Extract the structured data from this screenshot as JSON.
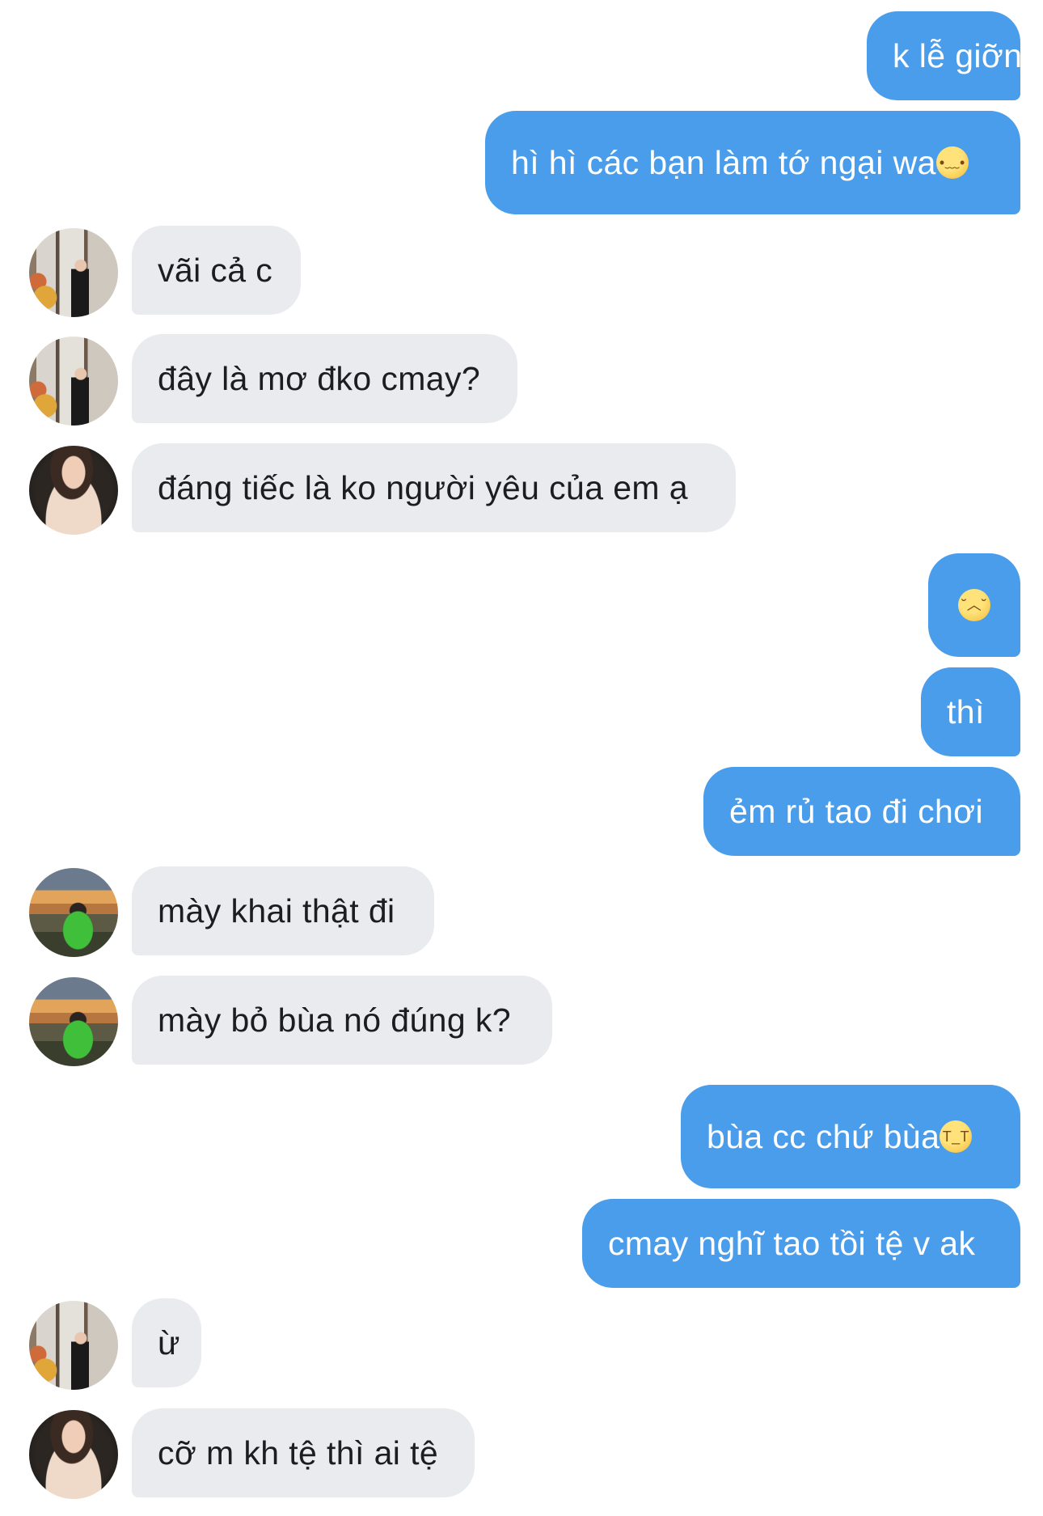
{
  "messages": [
    {
      "side": "out",
      "text": "k lễ giỡn"
    },
    {
      "side": "out",
      "text": "hì hì các bạn làm tớ ngại wa",
      "emoji": "shy-face-emoji"
    },
    {
      "side": "in",
      "avatar": "store-photo-avatar",
      "text": "vãi cả c"
    },
    {
      "side": "in",
      "avatar": "store-photo-avatar",
      "text": "đây là mơ đko cmay?"
    },
    {
      "side": "in",
      "avatar": "girl-portrait-avatar",
      "text": "đáng tiếc là ko người yêu của em ạ"
    },
    {
      "side": "out",
      "text": "",
      "emoji": "pensive-face-emoji"
    },
    {
      "side": "out",
      "text": "thì"
    },
    {
      "side": "out",
      "text": "ẻm rủ tao đi chơi"
    },
    {
      "side": "in",
      "avatar": "sunset-photo-avatar",
      "text": "mày khai thật đi"
    },
    {
      "side": "in",
      "avatar": "sunset-photo-avatar",
      "text": "mày bỏ bùa nó đúng k?"
    },
    {
      "side": "out",
      "text": "bùa cc chứ bùa",
      "emoji": "crying-face-emoji"
    },
    {
      "side": "out",
      "text": "cmay nghĩ tao tồi tệ v ak"
    },
    {
      "side": "in",
      "avatar": "store-photo-avatar",
      "text": "ừ"
    },
    {
      "side": "in",
      "avatar": "girl-portrait-avatar",
      "text": "cỡ m kh tệ thì ai tệ"
    }
  ],
  "colors": {
    "outgoing_bubble": "#4a9deb",
    "incoming_bubble": "#e9ebef",
    "incoming_text": "#1c1d1f",
    "outgoing_text": "#ffffff"
  }
}
